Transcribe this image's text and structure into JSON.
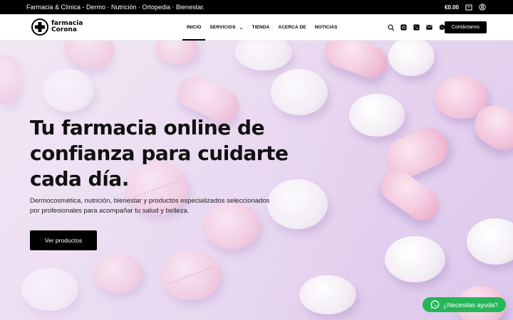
{
  "topbar": {
    "tagline": "Farmacia & Clínica - Dermo · Nutrición · Ortopedia · Bienestar.",
    "cart_total": "€0.00"
  },
  "header": {
    "logo": {
      "line1": "farmacia",
      "line2": "Corona"
    },
    "nav": [
      {
        "label": "INICIO",
        "active": true
      },
      {
        "label": "SERVICIOS",
        "has_dropdown": true
      },
      {
        "label": "TIENDA"
      },
      {
        "label": "ACERCA DE"
      },
      {
        "label": "NOTICIAS"
      }
    ],
    "icons": [
      "search-icon",
      "instagram-icon",
      "phone-icon",
      "mail-icon",
      "whatsapp-icon"
    ],
    "contact_label": "Contáctanos"
  },
  "hero": {
    "title": "Tu farmacia online de confianza para cuidarte cada día.",
    "subtitle": "Dermocosmética, nutrición, bienestar y productos especializados seleccionados por profesionales para acompañar tu salud y belleza.",
    "cta_label": "Ver productos"
  },
  "whatsapp": {
    "label": "¿Necesitas ayuda?",
    "color": "#25b659"
  }
}
